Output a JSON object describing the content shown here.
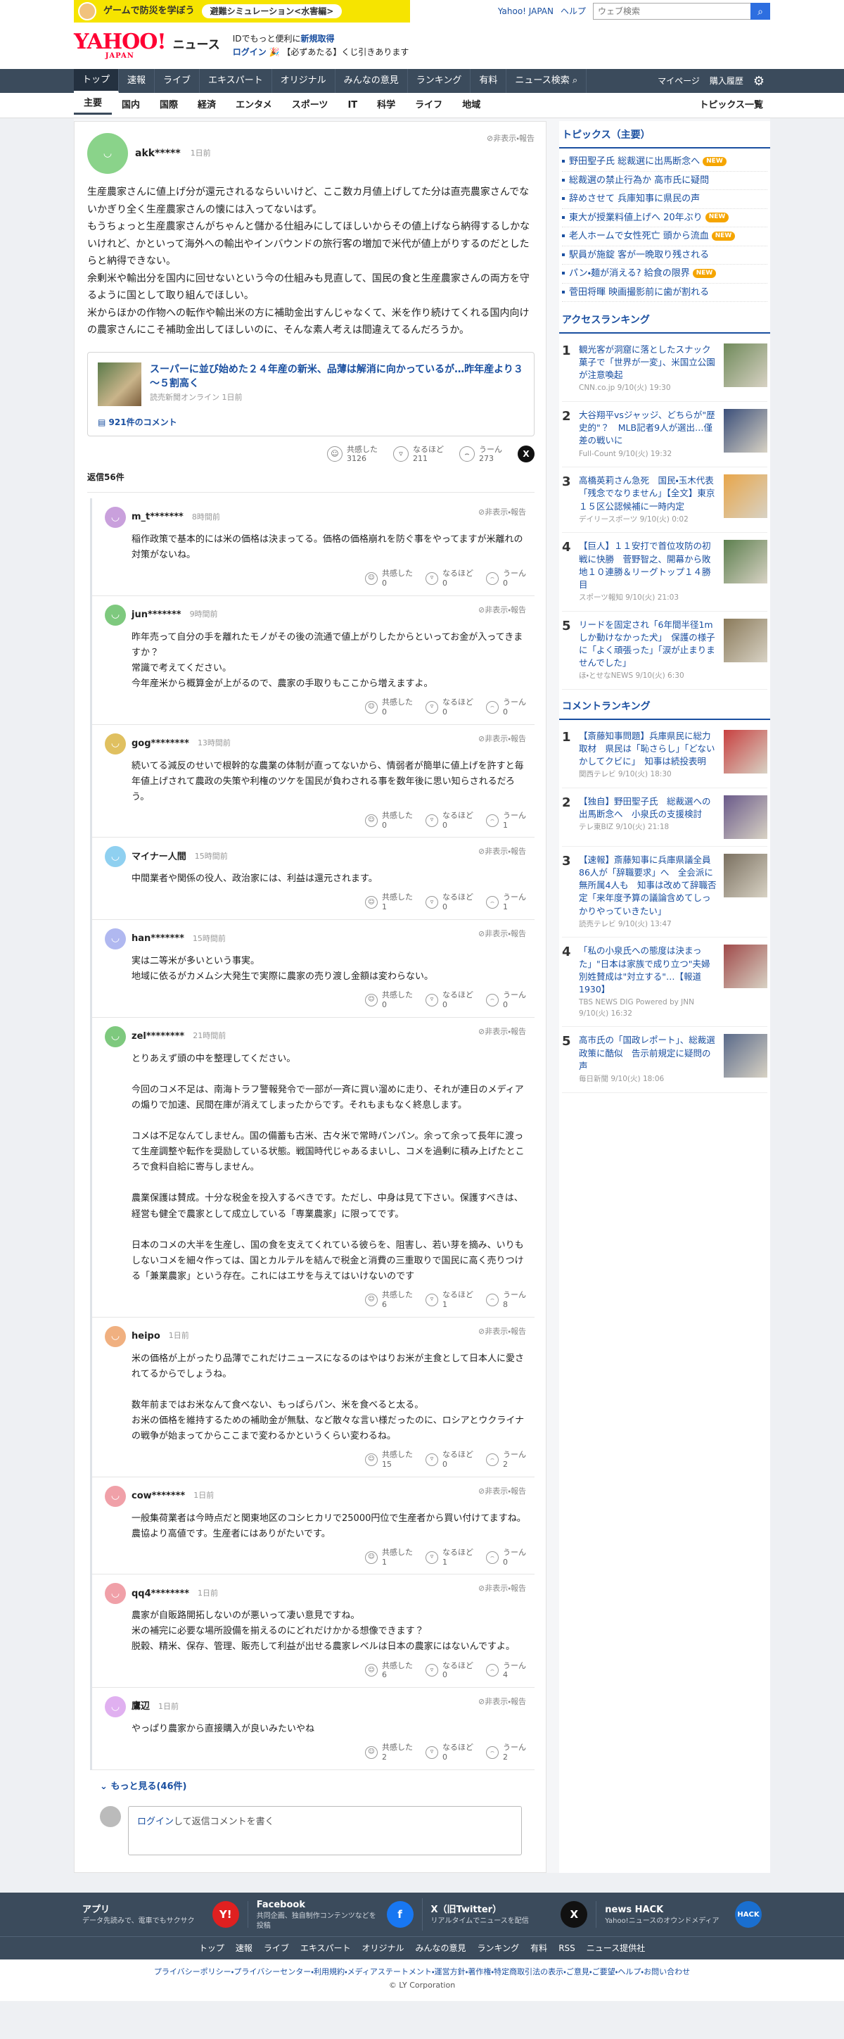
{
  "topbar": {
    "banner_text_a": "ゲームで防災を学ぼう",
    "banner_pill": "避難シミュレーション<水害編>",
    "yahoo_japan": "Yahoo! JAPAN",
    "help": "ヘルプ",
    "search_placeholder": "ウェブ検索"
  },
  "header": {
    "logo_main": "YAHOO!",
    "logo_sub": "JAPAN",
    "logo_news": "ニュース",
    "line1_a": "IDでもっと便利に",
    "line1_b": "新規取得",
    "line2_a": "ログイン",
    "line2_b": "【必ずあたる】くじ引きあります"
  },
  "nav": {
    "items": [
      "トップ",
      "速報",
      "ライブ",
      "エキスパート",
      "オリジナル",
      "みんなの意見",
      "ランキング",
      "有料",
      "ニュース検索"
    ],
    "mypage": "マイページ",
    "history": "購入履歴"
  },
  "subnav": {
    "items": [
      "主要",
      "国内",
      "国際",
      "経済",
      "エンタメ",
      "スポーツ",
      "IT",
      "科学",
      "ライフ",
      "地域"
    ],
    "topics_all": "トピックス一覧"
  },
  "top_comment": {
    "user": "akk*****",
    "time": "1日前",
    "flags": "非表示・報告",
    "body": "生産農家さんに値上げ分が還元されるならいいけど、ここ数カ月値上げしてた分は直売農家さんでないかぎり全く生産農家さんの懐には入ってないはず。\nもうちょっと生産農家さんがちゃんと儲かる仕組みにしてほしいからその値上げなら納得するしかないけれど、かといって海外への輸出やインバウンドの旅行客の増加で米代が値上がりするのだとしたらと納得できない。\n余剰米や輸出分を国内に回せないという今の仕組みも見直して、国民の食と生産農家さんの両方を守るように国として取り組んでほしい。\n米からほかの作物への転作や輸出米の方に補助金出すんじゃなくて、米を作り続けてくれる国内向けの農家さんにこそ補助金出してほしいのに、そんな素人考えは間違えてるんだろうか。",
    "article_title": "スーパーに並び始めた２４年産の新米、品薄は解消に向かっているが…昨年産より３～５割高く",
    "article_meta": "読売新聞オンライン 1日前",
    "article_comments": "921件のコメント",
    "react1_label": "共感した",
    "react1_count": "3126",
    "react2_label": "なるほど",
    "react2_count": "211",
    "react3_label": "うーん",
    "react3_count": "273",
    "reply_count": "返信56件"
  },
  "replies": [
    {
      "user": "m_t*******",
      "time": "8時間前",
      "flags": "非表示・報告",
      "body": "稲作政策で基本的には米の価格は決まってる。価格の価格崩れを防ぐ事をやってますが米離れの対策がないね。",
      "r1": "0",
      "r2": "0",
      "r3": "0",
      "color": "#c9a0dc"
    },
    {
      "user": "jun*******",
      "time": "9時間前",
      "flags": "非表示・報告",
      "body": "昨年売って自分の手を離れたモノがその後の流通で値上がりしたからといってお金が入ってきますか？\n常識で考えてください。\n今年産米から概算金が上がるので、農家の手取りもここから増えますよ。",
      "r1": "0",
      "r2": "0",
      "r3": "0",
      "color": "#7ec97e"
    },
    {
      "user": "gog********",
      "time": "13時間前",
      "flags": "非表示・報告",
      "body": "続いてる減反のせいで根幹的な農業の体制が直ってないから、情弱者が簡単に値上げを許すと毎年値上げされて農政の失策や利権のツケを国民が負わされる事を数年後に思い知らされるだろう。",
      "r1": "0",
      "r2": "0",
      "r3": "1",
      "color": "#e0c060"
    },
    {
      "user": "マイナー人間",
      "time": "15時間前",
      "flags": "非表示・報告",
      "body": "中間業者や関係の役人、政治家には、利益は還元されます。",
      "r1": "1",
      "r2": "0",
      "r3": "1",
      "color": "#8fd0f0"
    },
    {
      "user": "han*******",
      "time": "15時間前",
      "flags": "非表示・報告",
      "body": "実は二等米が多いという事実。\n地域に依るがカメムシ大発生で実際に農家の売り渡し金額は変わらない。",
      "r1": "0",
      "r2": "0",
      "r3": "0",
      "color": "#b0b8f0"
    },
    {
      "user": "zel********",
      "time": "21時間前",
      "flags": "非表示・報告",
      "body": "とりあえず頭の中を整理してください。\n\n今回のコメ不足は、南海トラフ警報発令で一部が一斉に買い溜めに走り、それが連日のメディアの煽りで加速、民間在庫が消えてしまったからです。それもまもなく終息します。\n\nコメは不足なんてしません。国の備蓄も古米、古々米で常時パンパン。余って余って長年に渡って生産調整や転作を奨励している状態。戦国時代じゃあるまいし、コメを過剰に積み上げたところで食料自給に寄与しません。\n\n農業保護は賛成。十分な税金を投入するべきです。ただし、中身は見て下さい。保護すべきは、経営も健全で農家として成立している「専業農家」に限ってです。\n\n日本のコメの大半を生産し、国の食を支えてくれている彼らを、阻害し、若い芽を摘み、いりもしないコメを細々作っては、国とカルテルを結んで税金と消費の三重取りで国民に高く売りつける「兼業農家」という存在。これにはエサを与えてはいけないのです",
      "r1": "6",
      "r2": "1",
      "r3": "8",
      "color": "#7ec97e"
    },
    {
      "user": "heipo",
      "time": "1日前",
      "flags": "非表示・報告",
      "body": "米の価格が上がったり品薄でこれだけニュースになるのはやはりお米が主食として日本人に愛されてるからでしょうね。\n\n数年前まではお米なんて食べない、もっぱらパン、米を食べると太る。\nお米の価格を維持するための補助金が無駄、など散々な言い様だったのに、ロシアとウクライナの戦争が始まってからここまで変わるかというくらい変わるね。",
      "r1": "15",
      "r2": "0",
      "r3": "2",
      "color": "#f0b080"
    },
    {
      "user": "cow*******",
      "time": "1日前",
      "flags": "非表示・報告",
      "body": "一般集荷業者は今時点だと関東地区のコシヒカリで25000円位で生産者から買い付けてますね。農協より高値です。生産者にはありがたいです。",
      "r1": "1",
      "r2": "1",
      "r3": "0",
      "color": "#f0a0a8"
    },
    {
      "user": "qq4********",
      "time": "1日前",
      "flags": "非表示・報告",
      "body": "農家が自販路開拓しないのが悪いって凄い意見ですね。\n米の補完に必要な場所設備を揃えるのにどれだけかかる想像できます？\n脱穀、精米、保存、管理、販売して利益が出せる農家レベルは日本の農家にはないんですよ。",
      "r1": "6",
      "r2": "0",
      "r3": "4",
      "color": "#f0a0a8"
    },
    {
      "user": "鷹辺",
      "time": "1日前",
      "flags": "非表示・報告",
      "body": "やっぱり農家から直接購入が良いみたいやね",
      "r1": "2",
      "r2": "0",
      "r3": "2",
      "color": "#e0b0f0"
    }
  ],
  "react_labels": {
    "a": "共感した",
    "b": "なるほど",
    "c": "うーん"
  },
  "more": {
    "label": "もっと見る",
    "count": "(46件)"
  },
  "login_box": {
    "link": "ログイン",
    "text": "して返信コメントを書く"
  },
  "sidebar": {
    "topics_title": "トピックス（主要）",
    "topics": [
      {
        "t": "野田聖子氏 総裁選に出馬断念へ",
        "new": true
      },
      {
        "t": "総裁選の禁止行為か 高市氏に疑問",
        "new": false
      },
      {
        "t": "辞めさせて 兵庫知事に県民の声",
        "new": false
      },
      {
        "t": "東大が授業料値上げへ 20年ぶり",
        "new": true
      },
      {
        "t": "老人ホームで女性死亡 頭から流血",
        "new": true
      },
      {
        "t": "駅員が施錠 客が一晩取り残される",
        "new": false
      },
      {
        "t": "パン・麺が消える? 給食の限界",
        "new": true
      },
      {
        "t": "菅田将暉 映画撮影前に歯が割れる",
        "new": false
      }
    ],
    "new_label": "NEW",
    "access_title": "アクセスランキング",
    "access": [
      {
        "n": "1",
        "t": "観光客が洞窟に落としたスナック菓子で「世界が一変」、米国立公園が注意喚起",
        "src": "CNN.co.jp 9/10(火) 19:30",
        "img": "#6f8a5a"
      },
      {
        "n": "2",
        "t": "大谷翔平vsジャッジ、どちらが\"歴史的\"？　MLB記者9人が選出…僅差の戦いに",
        "src": "Full-Count 9/10(火) 19:32",
        "img": "#3b4f7a"
      },
      {
        "n": "3",
        "t": "高橋英莉さん急死　国民・玉木代表「残念でなりません」【全文】東京１５区公認候補に一時内定",
        "src": "デイリースポーツ 9/10(火) 0:02",
        "img": "#e8a64a"
      },
      {
        "n": "4",
        "t": "【巨人】１１安打で首位攻防の初戦に快勝　菅野智之、開幕から敗地１０連勝＆リーグトップ１４勝目",
        "src": "スポーツ報知 9/10(火) 21:03",
        "img": "#5c7f4e"
      },
      {
        "n": "5",
        "t": "リードを固定され「6年間半径1mしか動けなかった犬」　保護の様子に「よく頑張った」「涙が止まりませんでした」",
        "src": "ほ・とせなNEWS 9/10(火) 6:30",
        "img": "#8a7a5a"
      }
    ],
    "comment_title": "コメントランキング",
    "comment_rank": [
      {
        "n": "1",
        "t": "【斎藤知事問題】兵庫県民に総力取材　県民は「恥さらし」「どないかしてクビに」　知事は続投表明",
        "src": "関西テレビ 9/10(火) 18:30",
        "img": "#c84040"
      },
      {
        "n": "2",
        "t": "【独自】野田聖子氏　総裁選への出馬断念へ　小泉氏の支援検討",
        "src": "テレ東BIZ 9/10(火) 21:18",
        "img": "#6a5a8a"
      },
      {
        "n": "3",
        "t": "【速報】斎藤知事に兵庫県議全員86人が「辞職要求」へ　全会派に無所属4人も　知事は改めて辞職否定「来年度予算の議論含めてしっかりやっていきたい」",
        "src": "読売テレビ 9/10(火) 13:47",
        "img": "#7a7060"
      },
      {
        "n": "4",
        "t": "「私の小泉氏への態度は決まった」\"日本は家族で成り立つ\"夫婦別姓賛成は\"対立する\"…【報道1930】",
        "src": "TBS NEWS DIG Powered by JNN 9/10(火) 16:32",
        "img": "#a04a4a"
      },
      {
        "n": "5",
        "t": "高市氏の「国政レポート」、総裁選政策に酷似　告示前規定に疑問の声",
        "src": "毎日新聞 9/10(火) 18:06",
        "img": "#5a6a8a"
      }
    ]
  },
  "footer": {
    "apps": [
      {
        "t": "アプリ",
        "d": "データ先読みで、電車でもサクサク",
        "ic": "Y!",
        "color": "#e02020"
      },
      {
        "t": "Facebook",
        "d": "共同企画、独自制作コンテンツなどを投稿",
        "ic": "f",
        "color": "#1877f2"
      },
      {
        "t": "X（旧Twitter）",
        "d": "リアルタイムでニュースを配信",
        "ic": "X",
        "color": "#111111"
      },
      {
        "t": "news HACK",
        "d": "Yahoo!ニュースのオウンドメディア",
        "ic": "HACK",
        "color": "#1a6fd0"
      }
    ],
    "nav": [
      "トップ",
      "速報",
      "ライブ",
      "エキスパート",
      "オリジナル",
      "みんなの意見",
      "ランキング",
      "有料",
      "RSS",
      "ニュース提供社"
    ],
    "links": "プライバシーポリシー・プライバシーセンター・利用規約・メディアステートメント・運営方針・著作権・特定商取引法の表示・ご意見・ご要望・ヘルプ・お問い合わせ",
    "copyright": "© LY Corporation"
  }
}
